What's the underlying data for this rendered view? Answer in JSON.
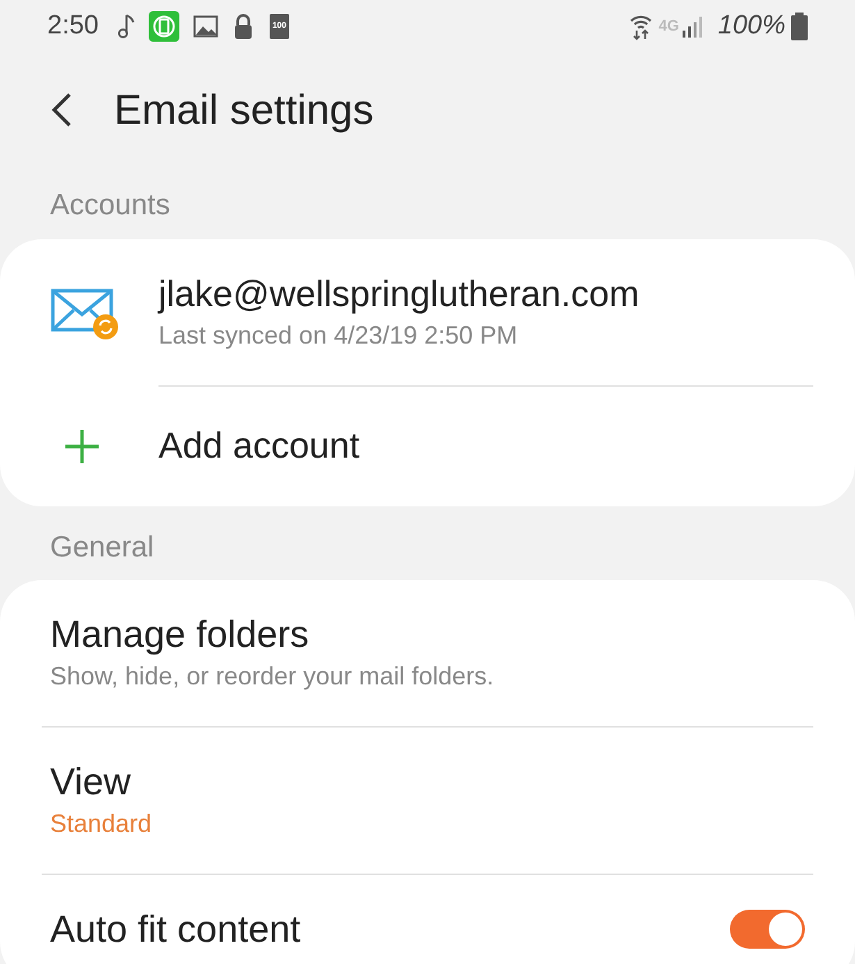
{
  "status_bar": {
    "time": "2:50",
    "battery_icon_text": "100",
    "network": "4G",
    "battery": "100%"
  },
  "header": {
    "title": "Email settings"
  },
  "sections": [
    {
      "title": "Accounts",
      "items": [
        {
          "kind": "account",
          "title": "jlake@wellspringlutheran.com",
          "subtitle": "Last synced on 4/23/19  2:50 PM"
        },
        {
          "kind": "add",
          "title": "Add account"
        }
      ]
    },
    {
      "title": "General",
      "items": [
        {
          "kind": "plain",
          "title": "Manage folders",
          "subtitle": "Show, hide, or reorder your mail folders."
        },
        {
          "kind": "value",
          "title": "View",
          "subtitle": "Standard"
        },
        {
          "kind": "switch",
          "title": "Auto fit content",
          "on": true
        }
      ]
    }
  ]
}
